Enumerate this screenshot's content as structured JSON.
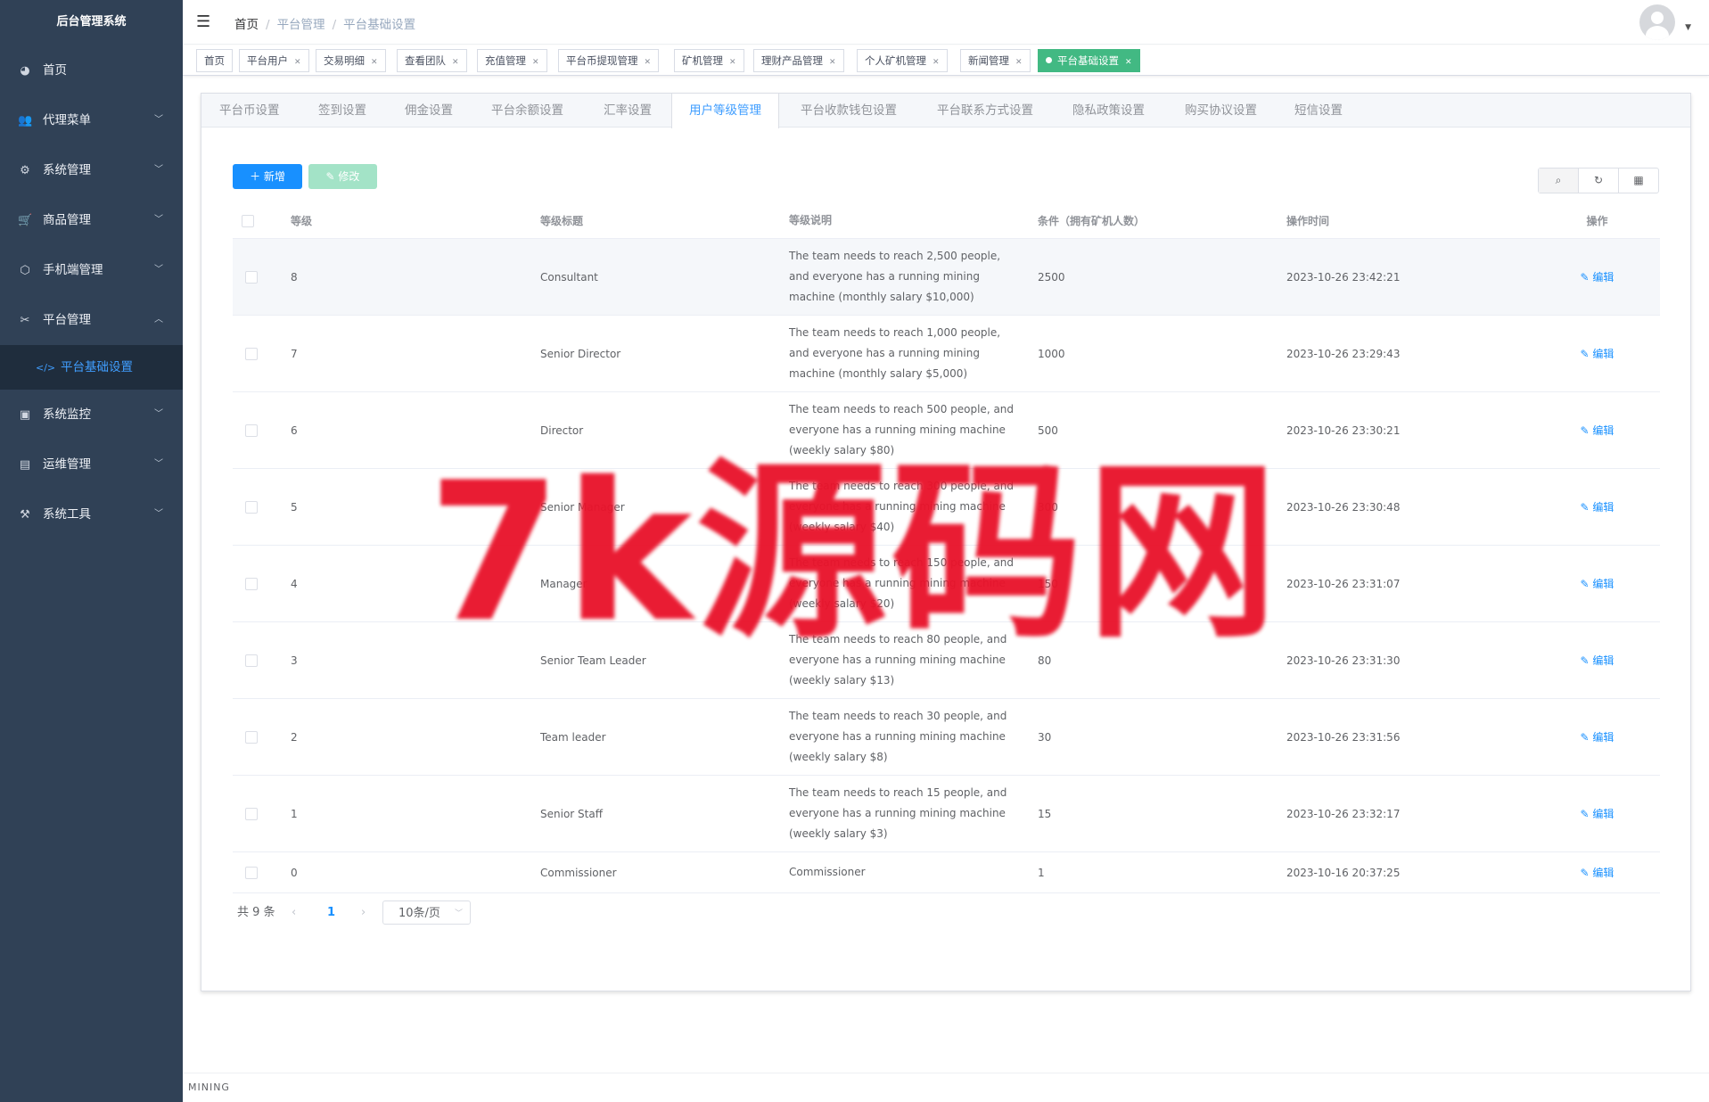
{
  "app": {
    "title": "后台管理系统"
  },
  "sidebar": {
    "items": [
      {
        "label": "首页",
        "icon": "dashboard-icon"
      },
      {
        "label": "代理菜单",
        "icon": "peoples-icon"
      },
      {
        "label": "系统管理",
        "icon": "system-icon"
      },
      {
        "label": "商品管理",
        "icon": "shopping-icon"
      },
      {
        "label": "手机端管理",
        "icon": "cube-icon"
      },
      {
        "label": "平台管理",
        "icon": "tool-icon"
      },
      {
        "label": "平台基础设置",
        "icon": "code-icon"
      },
      {
        "label": "系统监控",
        "icon": "monitor-icon"
      },
      {
        "label": "运维管理",
        "icon": "table-icon"
      },
      {
        "label": "系统工具",
        "icon": "build-icon"
      }
    ]
  },
  "breadcrumb": [
    "首页",
    "平台管理",
    "平台基础设置"
  ],
  "tags": [
    {
      "label": "首页"
    },
    {
      "label": "平台用户"
    },
    {
      "label": "交易明细"
    },
    {
      "label": "查看团队"
    },
    {
      "label": "充值管理"
    },
    {
      "label": "平台币提现管理"
    },
    {
      "label": "矿机管理"
    },
    {
      "label": "理财产品管理"
    },
    {
      "label": "个人矿机管理"
    },
    {
      "label": "新闻管理"
    },
    {
      "label": "平台基础设置"
    }
  ],
  "tabs": [
    "平台币设置",
    "签到设置",
    "佣金设置",
    "平台余额设置",
    "汇率设置",
    "用户等级管理",
    "平台收款钱包设置",
    "平台联系方式设置",
    "隐私政策设置",
    "购买协议设置",
    "短信设置"
  ],
  "toolbar": {
    "add": "新增",
    "edit": "修改"
  },
  "table": {
    "headers": {
      "level": "等级",
      "title": "等级标题",
      "desc": "等级说明",
      "cond": "条件（拥有矿机人数）",
      "time": "操作时间",
      "op": "操作"
    },
    "edit_label": "编辑",
    "rows": [
      {
        "level": "8",
        "title": "Consultant",
        "desc": "The team needs to reach 2,500 people, and everyone has a running mining machine (monthly salary $10,000)",
        "cond": "2500",
        "time": "2023-10-26 23:42:21"
      },
      {
        "level": "7",
        "title": "Senior Director",
        "desc": "The team needs to reach 1,000 people, and everyone has a running mining machine (monthly salary $5,000)",
        "cond": "1000",
        "time": "2023-10-26 23:29:43"
      },
      {
        "level": "6",
        "title": "Director",
        "desc": "The team needs to reach 500 people, and everyone has a running mining machine (weekly salary $80)",
        "cond": "500",
        "time": "2023-10-26 23:30:21"
      },
      {
        "level": "5",
        "title": "Senior Manager",
        "desc": "The team needs to reach 300 people, and everyone has a running mining machine (weekly salary $40)",
        "cond": "300",
        "time": "2023-10-26 23:30:48"
      },
      {
        "level": "4",
        "title": "Manager",
        "desc": "The team needs to reach 150 people, and everyone has a running mining machine (weekly salary $20)",
        "cond": "150",
        "time": "2023-10-26 23:31:07"
      },
      {
        "level": "3",
        "title": "Senior Team Leader",
        "desc": "The team needs to reach 80 people, and everyone has a running mining machine (weekly salary $13)",
        "cond": "80",
        "time": "2023-10-26 23:31:30"
      },
      {
        "level": "2",
        "title": "Team leader",
        "desc": "The team needs to reach 30 people, and everyone has a running mining machine (weekly salary $8)",
        "cond": "30",
        "time": "2023-10-26 23:31:56"
      },
      {
        "level": "1",
        "title": "Senior Staff",
        "desc": "The team needs to reach 15 people, and everyone has a running mining machine (weekly salary $3)",
        "cond": "15",
        "time": "2023-10-26 23:32:17"
      },
      {
        "level": "0",
        "title": "Commissioner",
        "desc": "Commissioner",
        "cond": "1",
        "time": "2023-10-16 20:37:25"
      }
    ]
  },
  "pagination": {
    "total": "共 9 条",
    "page": "1",
    "size": "10条/页"
  },
  "footer": "MINING",
  "watermark": "7k源码网",
  "colors": {
    "sidebar": "#304156",
    "primary": "#1890ff",
    "tag_active": "#42b983",
    "watermark": "#e9132b"
  }
}
